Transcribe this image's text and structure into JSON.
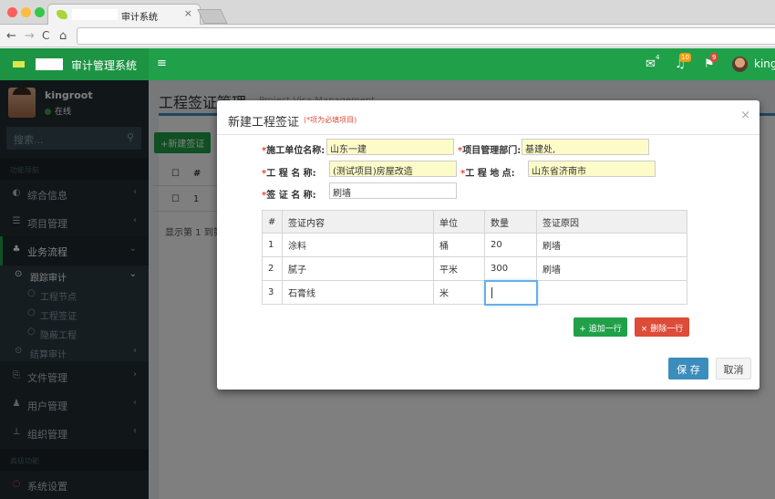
{
  "browser": {
    "tab_title": "审计系统",
    "tab_close": "×",
    "nav_back": "←",
    "nav_forward": "→",
    "nav_reload": "C",
    "nav_home": "⌂"
  },
  "header": {
    "app_title": "审计管理系统",
    "menu_icon": "≡",
    "mail_badge": "4",
    "bell_badge": "10",
    "flag_badge": "9",
    "user_name": "kingr"
  },
  "sidebar": {
    "user_name": "kingroot",
    "user_status": "在线",
    "search_placeholder": "搜索...",
    "section_nav": "功能导航",
    "section_adv": "高级功能",
    "items": [
      {
        "label": "综合信息",
        "icon": "dashboard-icon"
      },
      {
        "label": "项目管理",
        "icon": "list-icon"
      },
      {
        "label": "业务流程",
        "icon": "sitemap-icon"
      },
      {
        "label": "文件管理",
        "icon": "file-icon"
      },
      {
        "label": "用户管理",
        "icon": "users-icon"
      },
      {
        "label": "组织管理",
        "icon": "org-icon"
      },
      {
        "label": "系统设置",
        "icon": "circle-icon"
      }
    ],
    "sub_track": "跟踪审计",
    "sub_items": [
      "工程节点",
      "工程签证",
      "隐蔽工程"
    ],
    "sub_settle": "结算审计"
  },
  "content": {
    "page_title": "工程签证管理",
    "page_subtitle": "Project Visa Management",
    "add_button": "+新建签证",
    "table_header_num": "#",
    "row1_num": "1",
    "footer_text": "显示第 1 到第"
  },
  "modal": {
    "title": "新建工程签证",
    "required_note": "(*项为必填项目)",
    "close": "×",
    "fields": {
      "construction_unit_label": "施工单位名称:",
      "construction_unit_value": "山东一建",
      "project_dept_label": "项目管理部门:",
      "project_dept_value": "基建处,",
      "project_name_label": "工 程 名 称:",
      "project_name_value": "(测试项目)房屋改造",
      "project_location_label": "工 程 地 点:",
      "project_location_value": "山东省济南市",
      "visa_name_label": "签 证 名 称:",
      "visa_name_value": "刷墙"
    },
    "table": {
      "headers": [
        "#",
        "签证内容",
        "单位",
        "数量",
        "签证原因"
      ],
      "rows": [
        [
          "1",
          "涂料",
          "桶",
          "20",
          "刷墙"
        ],
        [
          "2",
          "腻子",
          "平米",
          "300",
          "刷墙"
        ],
        [
          "3",
          "石膏线",
          "米",
          "",
          ""
        ]
      ]
    },
    "add_row_button": "+ 追加一行",
    "delete_row_button": "× 删除一行",
    "save_button": "保 存",
    "cancel_button": "取消"
  },
  "colors": {
    "header_green": "#1fa049",
    "sidebar_dark": "#222d32",
    "primary_blue": "#3c8dbc",
    "danger_red": "#dd4b39",
    "required_bg": "#fdfcc9"
  }
}
